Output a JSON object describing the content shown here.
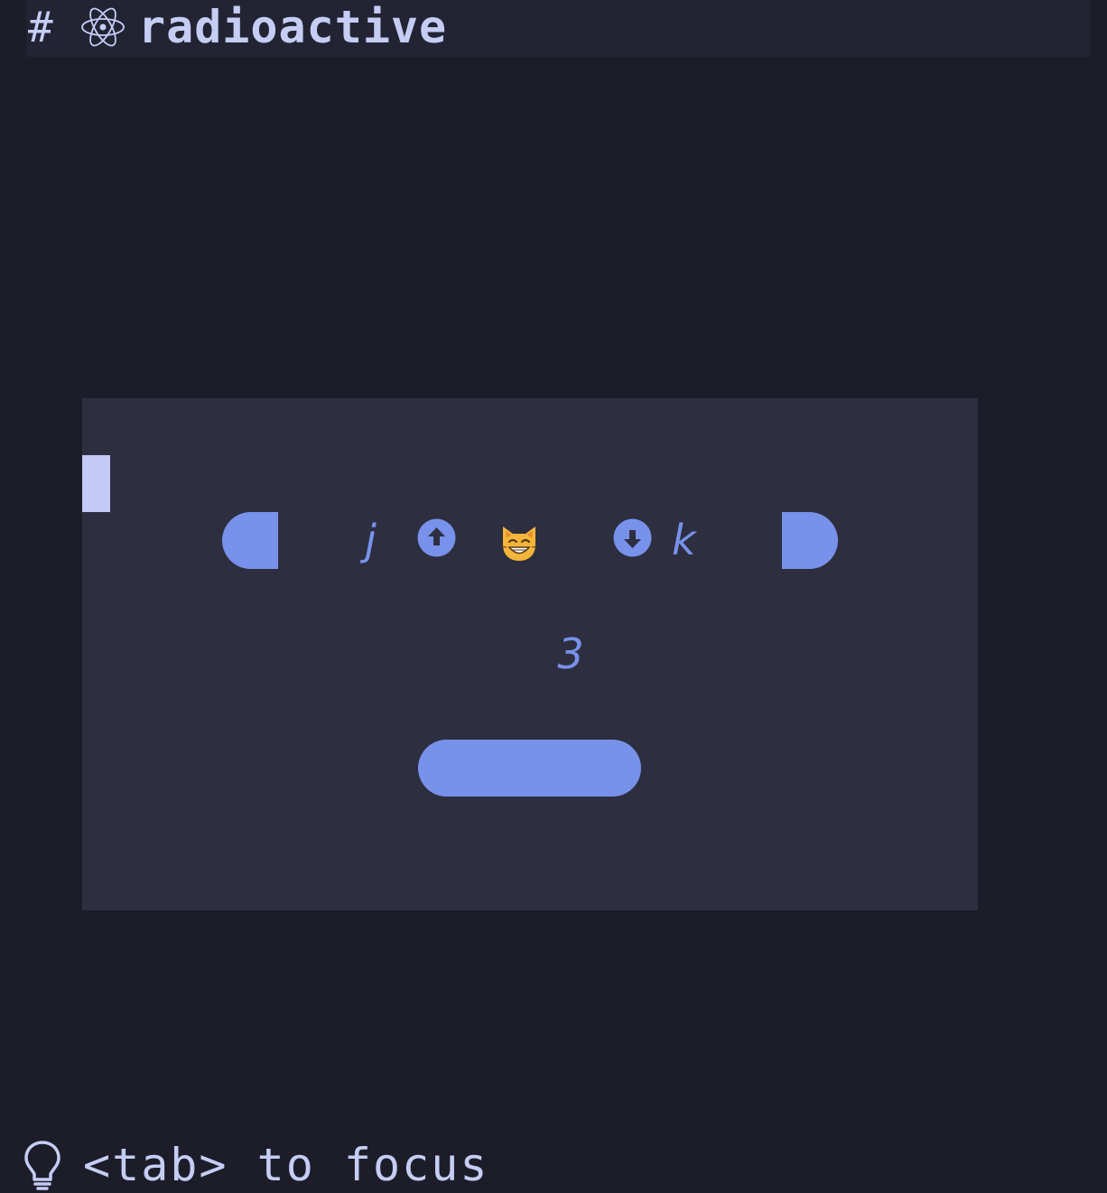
{
  "header": {
    "prefix": "#",
    "title": "radioactive",
    "icon": "atom-icon"
  },
  "counter": {
    "decrement_key": "j",
    "increment_key": "k",
    "decrement_icon": "arrow-up-circle-icon",
    "increment_icon": "arrow-down-circle-icon",
    "emoji": "grinning-cat-icon",
    "value": "3"
  },
  "footer": {
    "hint_icon": "lightbulb-icon",
    "hint": "<tab> to focus"
  },
  "colors": {
    "background": "#1d1d29",
    "header_background": "#232433",
    "panel_background": "#2d2e40",
    "accent": "#7891ea",
    "text": "#c6cdf5",
    "cursor": "#c4caf5"
  }
}
